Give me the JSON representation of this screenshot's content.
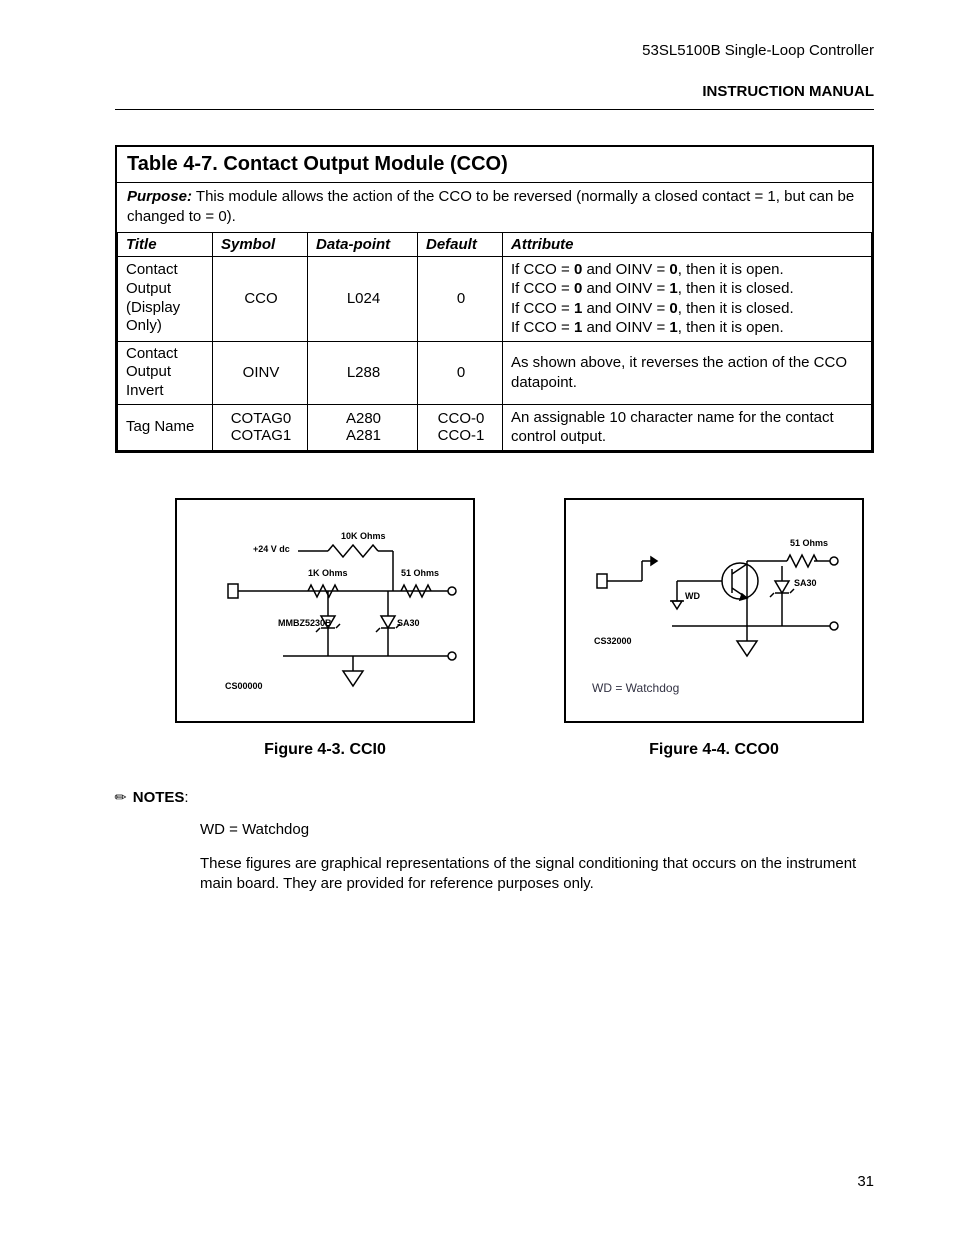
{
  "header": {
    "doc_title": "53SL5100B Single-Loop Controller",
    "manual_title": "INSTRUCTION MANUAL"
  },
  "table": {
    "title": "Table 4-7. Contact Output Module (CCO)",
    "purpose_label": "Purpose:",
    "purpose_text": " This module allows the action of the CCO to be reversed (normally a closed contact = 1, but can be changed to = 0).",
    "headers": {
      "title": "Title",
      "symbol": "Symbol",
      "datapoint": "Data-point",
      "default": "Default",
      "attribute": "Attribute"
    },
    "rows": [
      {
        "title": "Contact Output (Display Only)",
        "symbol": "CCO",
        "datapoint": "L024",
        "default": "0",
        "attr_lines": [
          {
            "pre": "If CCO = ",
            "b1": "0",
            "mid": " and OINV = ",
            "b2": "0",
            "post": ", then it is open."
          },
          {
            "pre": "If CCO = ",
            "b1": "0",
            "mid": " and OINV = ",
            "b2": "1",
            "post": ", then it is closed."
          },
          {
            "pre": "If CCO = ",
            "b1": "1",
            "mid": " and OINV = ",
            "b2": "0",
            "post": ", then it is closed."
          },
          {
            "pre": "If CCO = ",
            "b1": "1",
            "mid": " and OINV = ",
            "b2": "1",
            "post": ", then it is open."
          }
        ]
      },
      {
        "title": "Contact Output Invert",
        "symbol": "OINV",
        "datapoint": "L288",
        "default": "0",
        "attr_plain": "As shown above, it reverses the action of the CCO datapoint."
      },
      {
        "title": "Tag Name",
        "symbol": "COTAG0\nCOTAG1",
        "datapoint": "A280\nA281",
        "default": "CCO-0\nCCO-1",
        "attr_plain": "An assignable 10 character name for the contact control output."
      }
    ]
  },
  "figures": {
    "left": {
      "caption": "Figure 4-3. CCI0",
      "labels": {
        "v": "+24 V dc",
        "r1": "10K Ohms",
        "r2": "1K Ohms",
        "r3": "51 Ohms",
        "d1": "MMBZ5230B",
        "d2": "SA30",
        "src": "CS00000"
      }
    },
    "right": {
      "caption": "Figure 4-4. CCO0",
      "labels": {
        "r": "51 Ohms",
        "d": "SA30",
        "wd": "WD",
        "src": "CS32000",
        "legend": "WD = Watchdog"
      }
    }
  },
  "notes": {
    "heading": "NOTES",
    "line1": "WD = Watchdog",
    "line2": "These figures are graphical representations of the signal conditioning that occurs on the instrument main board. They are provided for reference purposes only."
  },
  "page_number": "31"
}
